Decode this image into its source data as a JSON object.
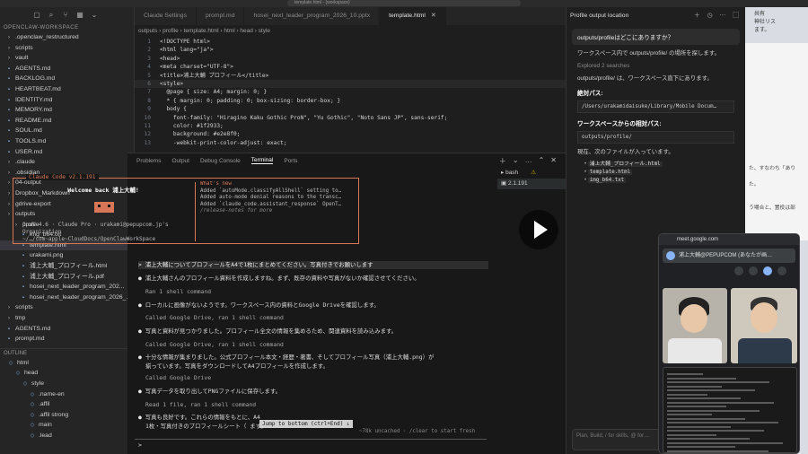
{
  "titlebar": {
    "command_center": "template.html - (workspace)"
  },
  "sidebar": {
    "explorer_title": "EXPLORER",
    "root": "OPENCLAW-WORKSPACE",
    "items": [
      {
        "label": ".openclaw_restructured",
        "type": "folder"
      },
      {
        "label": "scripts",
        "type": "folder"
      },
      {
        "label": "vault",
        "type": "folder"
      },
      {
        "label": "AGENTS.md",
        "type": "file"
      },
      {
        "label": "BACKLOG.md",
        "type": "file"
      },
      {
        "label": "HEARTBEAT.md",
        "type": "file"
      },
      {
        "label": "IDENTITY.md",
        "type": "file"
      },
      {
        "label": "MEMORY.md",
        "type": "file"
      },
      {
        "label": "README.md",
        "type": "file"
      },
      {
        "label": "SOUL.md",
        "type": "file"
      },
      {
        "label": "TOOLS.md",
        "type": "file"
      },
      {
        "label": "USER.md",
        "type": "file"
      },
      {
        "label": ".claude",
        "type": "folder"
      },
      {
        "label": ".obsidian",
        "type": "folder"
      },
      {
        "label": "04-output",
        "type": "folder"
      },
      {
        "label": "Dropbox_Markdown",
        "type": "folder"
      },
      {
        "label": "gdrive-export",
        "type": "folder"
      },
      {
        "label": "outputs",
        "type": "folder"
      },
      {
        "label": "profile",
        "type": "folder"
      },
      {
        "label": "img_b64.txt",
        "type": "file"
      },
      {
        "label": "template.html",
        "type": "file",
        "active": true
      },
      {
        "label": "urakami.png",
        "type": "file"
      },
      {
        "label": "浦上大輔_プロフィール.html",
        "type": "file"
      },
      {
        "label": "浦上大輔_プロフィール.pdf",
        "type": "file"
      },
      {
        "label": "hosei_next_leader_program_202...",
        "type": "file"
      },
      {
        "label": "hosei_next_leader_program_2026_...",
        "type": "file"
      },
      {
        "label": "scripts",
        "type": "folder"
      },
      {
        "label": "tmp",
        "type": "folder"
      },
      {
        "label": "AGENTS.md",
        "type": "file"
      },
      {
        "label": "prompt.md",
        "type": "file"
      }
    ],
    "outline_title": "OUTLINE",
    "outline": [
      {
        "label": "html"
      },
      {
        "label": "head"
      },
      {
        "label": "style"
      },
      {
        "label": ".name-en"
      },
      {
        "label": ".affil"
      },
      {
        "label": ".affil strong"
      },
      {
        "label": "main"
      },
      {
        "label": ".lead"
      }
    ]
  },
  "tabs": [
    {
      "label": "Claude Settings",
      "active": false
    },
    {
      "label": "prompt.md",
      "active": false
    },
    {
      "label": "hosei_next_leader_program_2026_10.pptx",
      "active": false
    },
    {
      "label": "template.html",
      "active": true
    }
  ],
  "breadcrumb": "outputs › profile › template.html › html › head › style",
  "code_lines": [
    {
      "n": "1",
      "t": "<!DOCTYPE html>"
    },
    {
      "n": "2",
      "t": "<html lang=\"ja\">"
    },
    {
      "n": "3",
      "t": "<head>"
    },
    {
      "n": "4",
      "t": "<meta charset=\"UTF-8\">"
    },
    {
      "n": "5",
      "t": "<title>浦上大輔 プロフィール</title>"
    },
    {
      "n": "6",
      "t": "<style>"
    },
    {
      "n": "7",
      "t": "  @page { size: A4; margin: 0; }"
    },
    {
      "n": "8",
      "t": "  * { margin: 0; padding: 0; box-sizing: border-box; }"
    },
    {
      "n": "9",
      "t": "  body {"
    },
    {
      "n": "10",
      "t": "    font-family: \"Hiragino Kaku Gothic ProN\", \"Yu Gothic\", \"Noto Sans JP\", sans-serif;"
    },
    {
      "n": "11",
      "t": "    color: #1f2933;"
    },
    {
      "n": "12",
      "t": "    background: #e2e8f0;"
    },
    {
      "n": "13",
      "t": "    -webkit-print-color-adjust: exact;"
    }
  ],
  "panel": {
    "tabs": [
      "Problems",
      "Output",
      "Debug Console",
      "Terminal",
      "Ports"
    ],
    "active_tab": "Terminal",
    "sessions": [
      "bash",
      "2.1.191"
    ]
  },
  "welcome": {
    "box_title": "Claude Code v2.1.191",
    "greeting": "Welcome back 浦上大輔!",
    "model": "Opus 4.6 · Claude Pro · urakami@pepupcom.jp's",
    "org": "Organization",
    "path": "~/…/com~apple~CloudDocs/OpenClawWorkSpace",
    "whats_new_title": "What's new",
    "whats_new": [
      "Added `autoMode.classifyAllShell` setting to…",
      "Added auto-mode denial reasons to the transc…",
      "Added `claude_code.assistant_response` OpenT…"
    ],
    "notes_hint": "/release-notes for more"
  },
  "terminal": {
    "user_msg": "> 浦上大輔についてプロフィールをA4で1枚にまとめてください。写真付きでお願いします",
    "lines": [
      {
        "kind": "bullet",
        "text": "浦上大輔さんのプロフィール資料を作成しますね。まず、既存の資料や写真がないか確認させてください。"
      },
      {
        "kind": "dim",
        "text": "Ran 1 shell command"
      },
      {
        "kind": "bullet",
        "text": "ローカルに画像がないようです。ワークスペース内の資料とGoogle Driveを確認します。"
      },
      {
        "kind": "dim",
        "text": "Called Google Drive, ran 1 shell command"
      },
      {
        "kind": "bullet",
        "text": "写真と資料が見つかりました。プロフィール全文の情報を集めるため、関連資料を読み込みます。"
      },
      {
        "kind": "dim",
        "text": "Called Google Drive, ran 1 shell command"
      },
      {
        "kind": "bullet",
        "text": "十分な情報が集まりました。公式プロフィール本文・経歴・著書、そしてプロフィール写真（浦上大輔.png）が"
      },
      {
        "kind": "cont",
        "text": "揃っています。写真をダウンロードしてA4プロフィールを作成します。"
      },
      {
        "kind": "dim",
        "text": "Called Google Drive"
      },
      {
        "kind": "bullet",
        "text": "写真データを取り出してPNGファイルに保存します。"
      },
      {
        "kind": "dim",
        "text": "Read 1 file, ran 1 shell command"
      },
      {
        "kind": "bullet",
        "text": "写真も良好です。これらの情報をもとに、A4"
      },
      {
        "kind": "cont",
        "text": "1枚・写真付きのプロフィールシート（                                 ます。"
      }
    ],
    "jump_label": "Jump to bottom (ctrl+End) ↓",
    "context": "~78k uncached · /clear to start fresh",
    "prompt": ">"
  },
  "chat": {
    "title": "Profile output location",
    "question": "outputs/profileはどこにありますか？",
    "p1": "ワークスペース内で outputs/profile/ の場所を探します。",
    "explored": "Explored 2 searches",
    "p2": "outputs/profile/ は、ワークスペース直下にあります。",
    "abs_heading": "絶対パス:",
    "abs_path": "/Users/urakamidaisuke/Library/Mobile Docum…",
    "rel_heading": "ワークスペースからの相対パス:",
    "rel_path": "outputs/profile/",
    "p3": "現在、次のファイルが入っています。",
    "files": [
      "浦上大輔_プロフィール.html",
      "template.html",
      "img_b64.txt"
    ],
    "input_placeholder": "Plan, Build, / for skills, @ for…"
  },
  "desktop": {
    "lines": [
      "共有",
      "神社リス",
      "ます。"
    ],
    "win_lines": [
      "た、すなわち「あり",
      "た。",
      "う場合と、置役は部"
    ]
  },
  "meet": {
    "url": "meet.google.com",
    "presenter": "浦上大輔@PEPUPCOM (あなたが画…"
  },
  "colors": {
    "accent": "#d77757",
    "background": "#1e1e1e",
    "meet_blue": "#8ab4f8"
  }
}
